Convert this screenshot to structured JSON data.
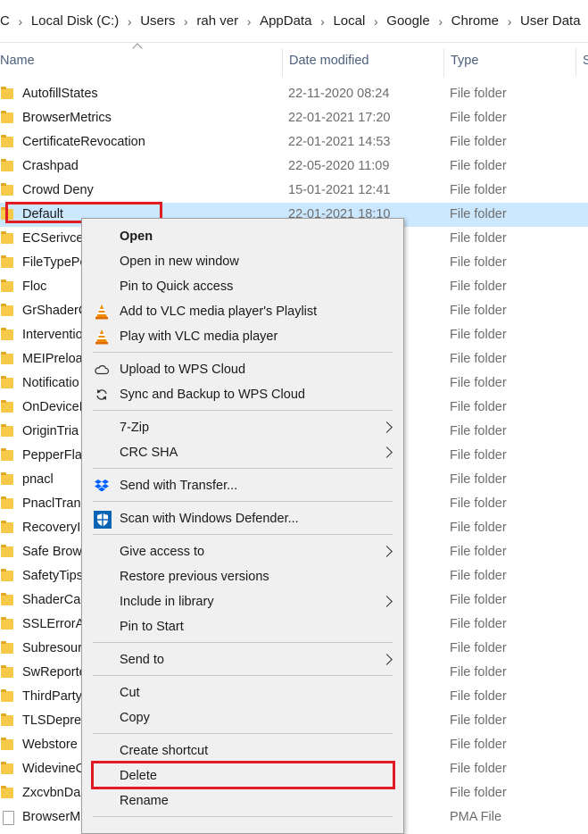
{
  "breadcrumb": [
    "C",
    "Local Disk (C:)",
    "Users",
    "rah ver",
    "AppData",
    "Local",
    "Google",
    "Chrome",
    "User Data"
  ],
  "columns": {
    "name": "Name",
    "date": "Date modified",
    "type": "Type",
    "size": "S"
  },
  "rows": [
    {
      "name": "AutofillStates",
      "date": "22-11-2020 08:24",
      "type": "File folder"
    },
    {
      "name": "BrowserMetrics",
      "date": "22-01-2021 17:20",
      "type": "File folder"
    },
    {
      "name": "CertificateRevocation",
      "date": "22-01-2021 14:53",
      "type": "File folder"
    },
    {
      "name": "Crashpad",
      "date": "22-05-2020 11:09",
      "type": "File folder"
    },
    {
      "name": "Crowd Deny",
      "date": "15-01-2021 12:41",
      "type": "File folder"
    },
    {
      "name": "Default",
      "date": "22-01-2021 18:10",
      "type": "File folder"
    },
    {
      "name": "ECSerivceI",
      "date": "",
      "type": "File folder"
    },
    {
      "name": "FileTypePo",
      "date": "",
      "type": "File folder"
    },
    {
      "name": "Floc",
      "date": "",
      "type": "File folder"
    },
    {
      "name": "GrShaderC",
      "date": "",
      "type": "File folder"
    },
    {
      "name": "Interventio",
      "date": "",
      "type": "File folder"
    },
    {
      "name": "MEIPreloa",
      "date": "",
      "type": "File folder"
    },
    {
      "name": "Notificatio",
      "date": "",
      "type": "File folder"
    },
    {
      "name": "OnDeviceI",
      "date": "",
      "type": "File folder"
    },
    {
      "name": "OriginTria",
      "date": "",
      "type": "File folder"
    },
    {
      "name": "PepperFla",
      "date": "",
      "type": "File folder"
    },
    {
      "name": "pnacl",
      "date": "",
      "type": "File folder"
    },
    {
      "name": "PnaclTrans",
      "date": "",
      "type": "File folder"
    },
    {
      "name": "RecoveryI",
      "date": "",
      "type": "File folder"
    },
    {
      "name": "Safe Brow",
      "date": "",
      "type": "File folder"
    },
    {
      "name": "SafetyTips",
      "date": "",
      "type": "File folder"
    },
    {
      "name": "ShaderCac",
      "date": "",
      "type": "File folder"
    },
    {
      "name": "SSLErrorA",
      "date": "",
      "type": "File folder"
    },
    {
      "name": "Subresour",
      "date": "",
      "type": "File folder"
    },
    {
      "name": "SwReporte",
      "date": "",
      "type": "File folder"
    },
    {
      "name": "ThirdParty",
      "date": "",
      "type": "File folder"
    },
    {
      "name": "TLSDeprec",
      "date": "",
      "type": "File folder"
    },
    {
      "name": "Webstore",
      "date": "",
      "type": "File folder"
    },
    {
      "name": "WidevineC",
      "date": "",
      "type": "File folder"
    },
    {
      "name": "ZxcvbnDa",
      "date": "",
      "type": "File folder"
    },
    {
      "name": "BrowserM",
      "date": "",
      "type": "PMA File"
    }
  ],
  "menu": {
    "open": "Open",
    "open_new_window": "Open in new window",
    "pin_quick_access": "Pin to Quick access",
    "vlc_playlist": "Add to VLC media player's Playlist",
    "vlc_play": "Play with VLC media player",
    "wps_upload": "Upload to WPS Cloud",
    "wps_sync": "Sync and Backup to WPS Cloud",
    "zip": "7-Zip",
    "crc": "CRC SHA",
    "transfer": "Send with Transfer...",
    "defender": "Scan with Windows Defender...",
    "give_access": "Give access to",
    "restore": "Restore previous versions",
    "include_library": "Include in library",
    "pin_start": "Pin to Start",
    "send_to": "Send to",
    "cut": "Cut",
    "copy": "Copy",
    "create_shortcut": "Create shortcut",
    "delete": "Delete",
    "rename": "Rename"
  },
  "colors": {
    "selection": "#cce8ff",
    "highlight": "#e01b24",
    "folder": "#f7c948"
  }
}
